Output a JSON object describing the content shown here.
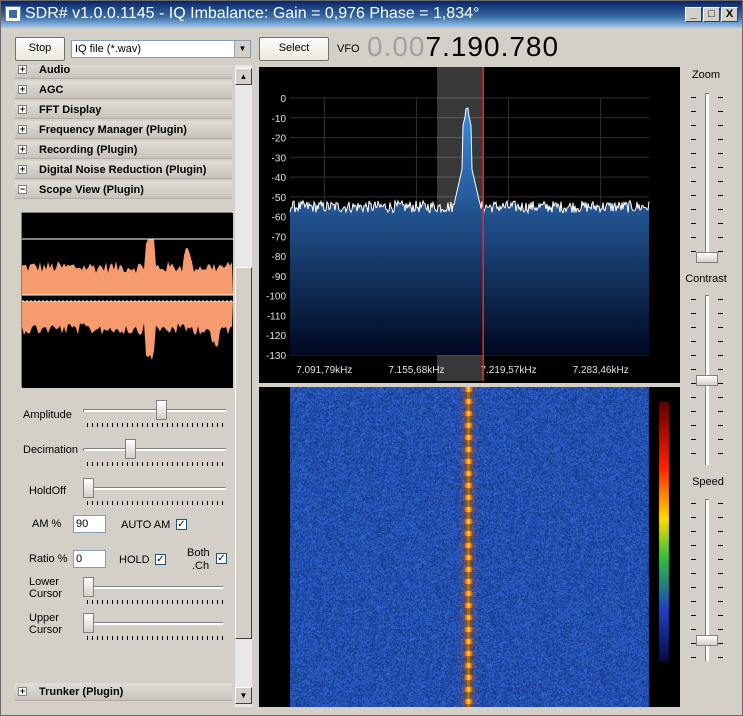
{
  "window": {
    "title": "SDR# v1.0.0.1145 - IQ Imbalance: Gain = 0,976 Phase = 1,834°",
    "min_label": "_",
    "max_label": "□",
    "close_label": "X"
  },
  "toolbar": {
    "stop_label": "Stop",
    "source_value": "IQ file (*.wav)",
    "select_label": "Select",
    "vfo_label": "VFO",
    "vfo_dim": "0.00",
    "vfo_bright": "7.190.780"
  },
  "sections": [
    {
      "label": "Audio",
      "state": "+"
    },
    {
      "label": "AGC",
      "state": "+"
    },
    {
      "label": "FFT Display",
      "state": "+"
    },
    {
      "label": "Frequency Manager (Plugin)",
      "state": "+"
    },
    {
      "label": "Recording (Plugin)",
      "state": "+"
    },
    {
      "label": "Digital Noise Reduction (Plugin)",
      "state": "+"
    },
    {
      "label": "Scope View (Plugin)",
      "state": "−"
    }
  ],
  "scope_controls": {
    "amplitude_label": "Amplitude",
    "amplitude_level": 0.55,
    "decimation_label": "Decimation",
    "decimation_level": 0.32,
    "holdoff_label": "HoldOff",
    "holdoff_level": 0.0,
    "am_label": "AM %",
    "am_value": "90",
    "auto_am_label": "AUTO AM",
    "auto_am_checked": true,
    "ratio_label": "Ratio %",
    "ratio_value": "0",
    "hold_label": "HOLD",
    "hold_checked": true,
    "both_ch_label_1": "Both",
    "both_ch_label_2": ".Ch",
    "both_ch_checked": true,
    "lower_cursor_label_1": "Lower",
    "lower_cursor_label_2": "Cursor",
    "lower_cursor_level": 0.0,
    "upper_cursor_label_1": "Upper",
    "upper_cursor_label_2": "Cursor",
    "upper_cursor_level": 0.0
  },
  "trunker_section": {
    "label": "Trunker (Plugin)",
    "state": "+"
  },
  "right_panel": {
    "zoom_label": "Zoom",
    "zoom_level": 0.0,
    "contrast_label": "Contrast",
    "contrast_level": 0.5,
    "speed_label": "Speed",
    "speed_level": 0.1
  },
  "chart_data": {
    "type": "line",
    "y_ticks": [
      "0",
      "-10",
      "-20",
      "-30",
      "-40",
      "-50",
      "-60",
      "-70",
      "-80",
      "-90",
      "-100",
      "-110",
      "-120",
      "-130"
    ],
    "ylim": [
      -130,
      0
    ],
    "x_ticks": [
      "7.091,79kHz",
      "7.155,68kHz",
      "7.219,57kHz",
      "7.283,46kHz"
    ],
    "x_tick_values_khz": [
      7091.79,
      7155.68,
      7219.57,
      7283.46
    ],
    "xlim_khz": [
      7068,
      7317
    ],
    "noise_floor_db": -55,
    "peak": {
      "freq_khz": 7190.78,
      "db": -5
    },
    "vfo_marker_khz": 7202,
    "filter_band_khz": [
      7181,
      7202
    ],
    "colors": {
      "spectrum_fill_top": "#3a8ae0",
      "spectrum_fill_bottom": "#000820",
      "trace": "#ffffff",
      "vfo_line": "#ff2020",
      "scope_fill": "#f59b6e"
    }
  }
}
